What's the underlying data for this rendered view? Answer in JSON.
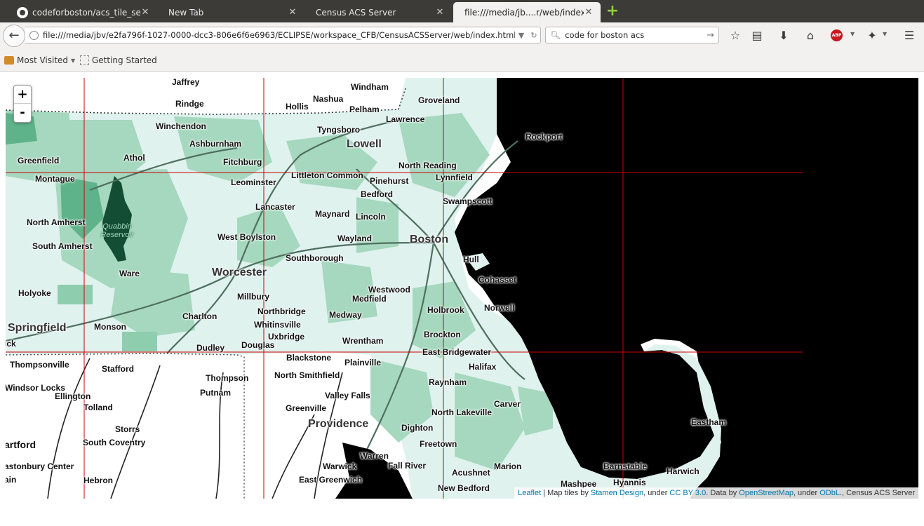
{
  "tabs": [
    {
      "label": "codeforboston/acs_tile_server",
      "icon": "github-icon",
      "active": false
    },
    {
      "label": "New Tab",
      "active": false
    },
    {
      "label": "Census ACS Server",
      "active": false
    },
    {
      "label": "file:///media/jb....r/web/index.html",
      "active": true
    }
  ],
  "nav": {
    "url": "file:///media/jbv/e2fa796f-1027-0000-dcc3-806e6f6e6963/ECLIPSE/workspace_CFB/CensusACSServer/web/index.html",
    "search_value": "code for boston acs"
  },
  "bookmarks": [
    {
      "label": "Most Visited",
      "icon": "folder-icon",
      "dropdown": true
    },
    {
      "label": "Getting Started",
      "icon": "page-icon"
    }
  ],
  "map": {
    "zoom_in": "+",
    "zoom_out": "-",
    "places": [
      "Jaffrey",
      "Rindge",
      "Hollis",
      "Nashua",
      "Windham",
      "Pelham",
      "Groveland",
      "Lawrence",
      "Winchendon",
      "Tyngsboro",
      "Rockport",
      "Ashburnham",
      "Lowell",
      "Greenfield",
      "Athol",
      "Fitchburg",
      "Littleton Common",
      "Pinehurst",
      "North Reading",
      "Lynnfield",
      "Montague",
      "Leominster",
      "Bedford",
      "Swampscott",
      "Lancaster",
      "Maynard",
      "Lincoln",
      "North Amherst",
      "Quabbin Reservoir",
      "West Boylston",
      "Wayland",
      "Boston",
      "South Amherst",
      "Southborough",
      "Hull",
      "Worcester",
      "Ware",
      "Cohasset",
      "Westwood",
      "Holyoke",
      "Millbury",
      "Medfield",
      "Norwell",
      "Northbridge",
      "Holbrook",
      "Medway",
      "Charlton",
      "Whitinsville",
      "Springfield",
      "Monson",
      "Brockton",
      "Uxbridge",
      "Wrentham",
      "Dudley",
      "Douglas",
      "East Bridgewater",
      "Thompsonville",
      "Blackstone",
      "Stafford",
      "Plainville",
      "Halifax",
      "Thompson",
      "North Smithfield",
      "Windsor Locks",
      "Raynham",
      "Putnam",
      "Ellington",
      "Valley Falls",
      "Tolland",
      "Greenville",
      "Carver",
      "North Lakeville",
      "Providence",
      "Storrs",
      "Dighton",
      "Eastham",
      "South Coventry",
      "Freetown",
      "artford",
      "Warren",
      "astonbury Center",
      "Warwick",
      "Fall River",
      "Marion",
      "Barnstable",
      "Acushnet",
      "Harwich",
      "ain",
      "Hebron",
      "East Greenwich",
      "New Bedford",
      "Mashpee",
      "Hyannis",
      "ick"
    ],
    "attribution": {
      "leaflet": "Leaflet",
      "sep1": " | Map tiles by ",
      "stamen": "Stamen Design",
      "sep2": ", under ",
      "ccby": "CC BY 3.0",
      "sep3": ". Data by ",
      "osm": "OpenStreetMap",
      "sep4": ", under ",
      "odbl": "ODbL",
      "sep5": "., Census ACS Server"
    }
  },
  "colors": {
    "tile_grid": "#cc0000",
    "ocean": "#000000",
    "choropleth_light": "#dff2ee",
    "choropleth_mid": "#a6d8bf",
    "choropleth_dark": "#5fb38a",
    "reservoir": "#134d33"
  }
}
